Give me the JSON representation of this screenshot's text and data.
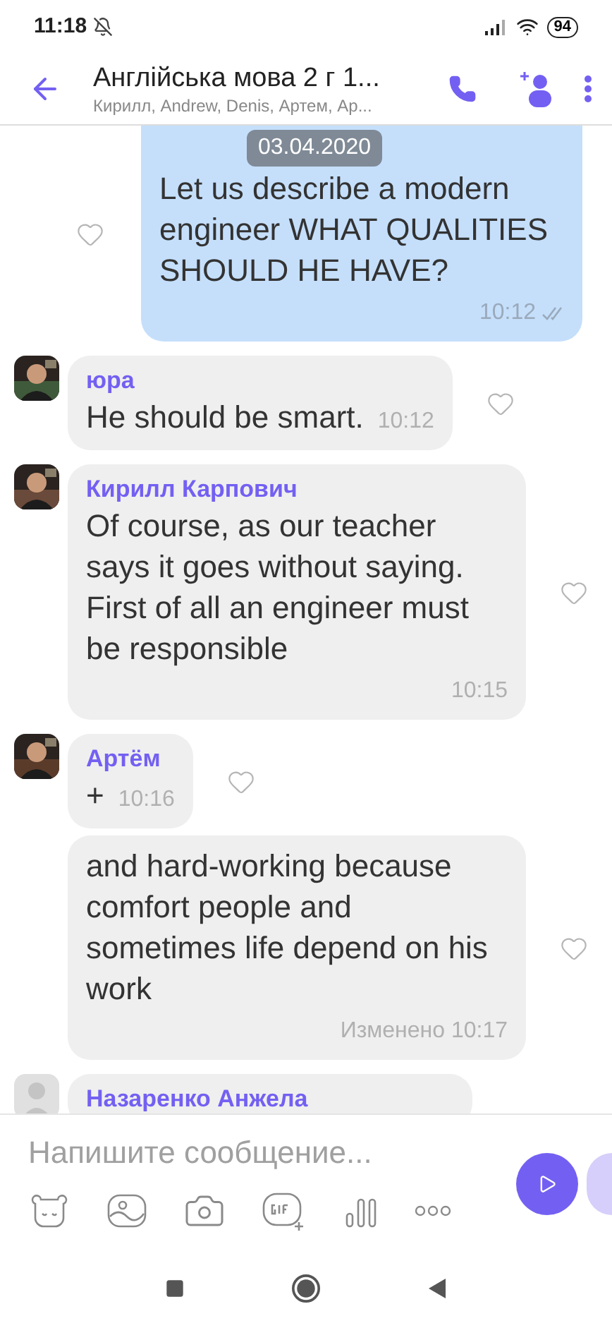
{
  "status_bar": {
    "time": "11:18",
    "battery": "94"
  },
  "header": {
    "title": "Англійська мова 2 г 1...",
    "subtitle": "Кирилл, Andrew, Denis, Артем, Ар..."
  },
  "date_chip": "03.04.2020",
  "messages": [
    {
      "kind": "outgoing",
      "text": "Let us describe a modern engineer WHAT QUALITIES SHOULD HE HAVE?",
      "time": "10:12",
      "read": true
    },
    {
      "kind": "incoming_inline",
      "sender": "юра",
      "text": "He should be smart.",
      "time": "10:12"
    },
    {
      "kind": "incoming",
      "sender": "Кирилл Карпович",
      "text": "Of course, as our teacher says it goes without saying. First of all an engineer must be responsible",
      "time": "10:15"
    },
    {
      "kind": "incoming_inline",
      "sender": "Артём",
      "text": "+",
      "time": "10:16"
    },
    {
      "kind": "continuation",
      "text": "and hard-working because comfort people and sometimes life depend on his work",
      "time": "Изменено 10:17"
    },
    {
      "kind": "incoming",
      "sender": "Назаренко Анжела",
      "avatar": {
        "kind": "placeholder"
      }
    }
  ],
  "composer": {
    "placeholder": "Напишите сообщение..."
  }
}
